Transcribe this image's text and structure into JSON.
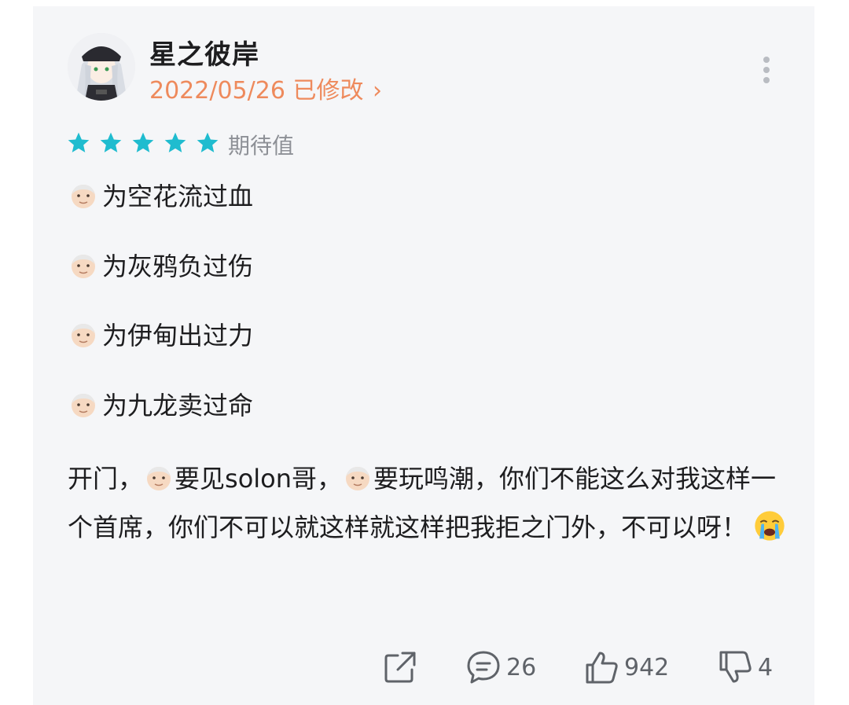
{
  "post": {
    "username": "星之彼岸",
    "date": "2022/05/26",
    "edited_label": "已修改",
    "edited_chevron": "›",
    "rating": {
      "stars": 5,
      "max": 5,
      "label": "期待值",
      "color": "#1fbccf"
    },
    "lines": [
      "为空花流过血",
      "为灰鸦负过伤",
      "为伊甸出过力",
      "为九龙卖过命"
    ],
    "paragraph": {
      "part1": "开门，",
      "part2": "要见solon哥，",
      "part3": "要玩鸣潮，你们不能这么对我这样一个首席，你们不可以就这样就这样把我拒之门外，不可以呀！"
    }
  },
  "icons": {
    "avatar": "avatar-girl",
    "more": "more-vertical-icon",
    "emoji_old_man": "old-man-emoji",
    "emoji_crying": "loudly-crying-emoji",
    "share": "share-icon",
    "comment": "comment-icon",
    "like": "thumbs-up-icon",
    "dislike": "thumbs-down-icon"
  },
  "footer": {
    "comments": "26",
    "likes": "942",
    "dislikes": "4"
  },
  "colors": {
    "accent_orange": "#ee8a5c",
    "star_teal": "#1fbccf",
    "text": "#1d1d1f",
    "muted": "#8d9096",
    "icon_gray": "#5f6369"
  }
}
